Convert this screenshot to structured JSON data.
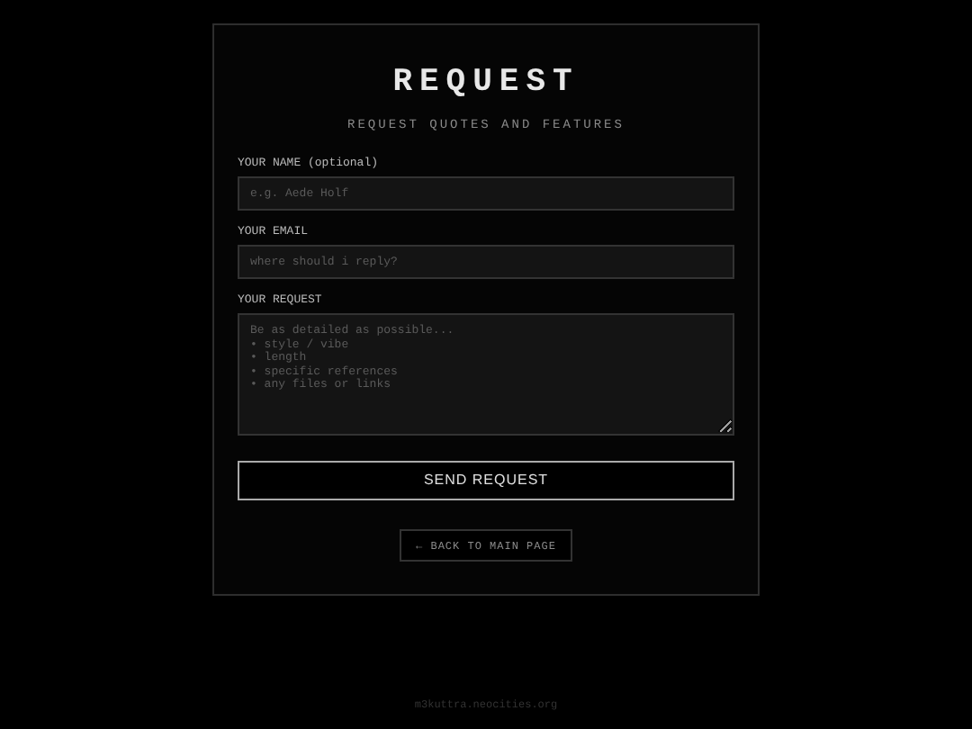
{
  "title": "REQUEST",
  "subtitle": "REQUEST QUOTES AND FEATURES",
  "fields": [
    {
      "kind": "input",
      "label": "YOUR NAME (optional)",
      "placeholder": "e.g. Aede Holf"
    },
    {
      "kind": "input",
      "label": "YOUR EMAIL",
      "placeholder": "where should i reply?"
    },
    {
      "kind": "textarea",
      "label": "YOUR REQUEST",
      "placeholder": "Be as detailed as possible...\n• style / vibe\n• length\n• specific references\n• any files or links"
    }
  ],
  "submit_button": "SEND REQUEST",
  "back_link": "← BACK TO MAIN PAGE",
  "footer": "m3kuttra.neocities.org"
}
